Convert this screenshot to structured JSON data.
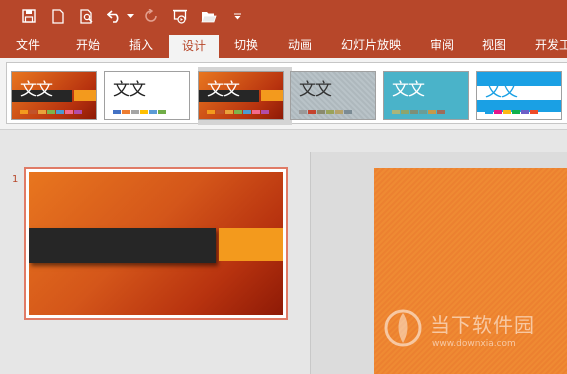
{
  "colors": {
    "accent": "#b7472a",
    "ribbon_bg": "#f3f3f3",
    "slide_orange": "#e8761f",
    "slide_dark": "#262626",
    "slide_accent": "#f39a1d"
  },
  "quick_access": {
    "icons": [
      "save-icon",
      "new-file-icon",
      "print-preview-icon",
      "undo-icon",
      "undo-dropdown-icon",
      "redo-icon",
      "start-slideshow-icon",
      "open-folder-icon",
      "customize-qat-icon"
    ]
  },
  "ribbon_tabs": [
    {
      "label": "文件",
      "active": false
    },
    {
      "label": "开始",
      "active": false
    },
    {
      "label": "插入",
      "active": false
    },
    {
      "label": "设计",
      "active": true
    },
    {
      "label": "切换",
      "active": false
    },
    {
      "label": "动画",
      "active": false
    },
    {
      "label": "幻灯片放映",
      "active": false
    },
    {
      "label": "审阅",
      "active": false
    },
    {
      "label": "视图",
      "active": false
    },
    {
      "label": "开发工",
      "active": false
    }
  ],
  "themes": [
    {
      "title": "文文",
      "style": "orange-band",
      "selected": false
    },
    {
      "title": "文文",
      "style": "white",
      "selected": false
    },
    {
      "title": "文文",
      "style": "orange-band",
      "selected": true
    },
    {
      "title": "文文",
      "style": "gray-texture",
      "selected": false
    },
    {
      "title": "文文",
      "style": "teal",
      "selected": false
    },
    {
      "title": "文文",
      "style": "blue-white",
      "selected": false
    }
  ],
  "slides": [
    {
      "number": "1"
    }
  ],
  "watermark": {
    "text": "当下软件园",
    "url": "www.downxia.com"
  }
}
